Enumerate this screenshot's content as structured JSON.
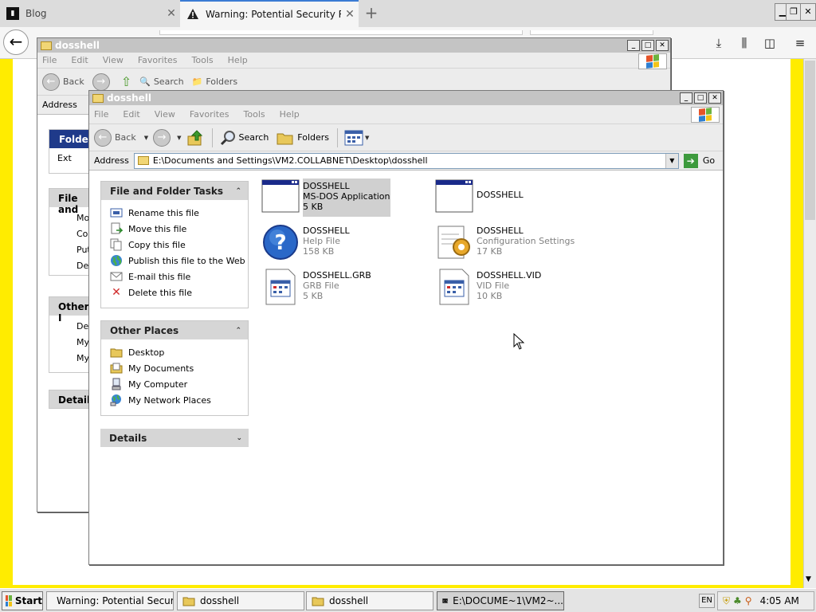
{
  "browser": {
    "tabs": [
      {
        "title": "Blog",
        "active": false
      },
      {
        "title": "Warning: Potential Security Risk A",
        "active": true
      }
    ],
    "new_tab": "+",
    "back": "←"
  },
  "back_window": {
    "title": "dosshell",
    "menu": [
      "File",
      "Edit",
      "View",
      "Favorites",
      "Tools",
      "Help"
    ],
    "back_label": "Back",
    "search_label": "Search",
    "folders_label": "Folders",
    "address_label": "Address",
    "panels": {
      "folder_head": "Folder",
      "folder_item": "Ext",
      "file_head": "File and",
      "file_items": [
        "Mo",
        "Cop",
        "Put",
        "Del"
      ],
      "other_head": "Other I",
      "other_items": [
        "Des",
        "My",
        "My"
      ],
      "details_head": "Details"
    }
  },
  "front_window": {
    "title": "dosshell",
    "menu": [
      "File",
      "Edit",
      "View",
      "Favorites",
      "Tools",
      "Help"
    ],
    "toolbar": {
      "back": "Back",
      "search": "Search",
      "folders": "Folders"
    },
    "address": {
      "label": "Address",
      "value": "E:\\Documents and Settings\\VM2.COLLABNET\\Desktop\\dosshell",
      "go": "Go"
    },
    "tasks_panel": {
      "title": "File and Folder Tasks",
      "items": [
        {
          "label": "Rename this file",
          "icon": "rename-icon"
        },
        {
          "label": "Move this file",
          "icon": "move-icon"
        },
        {
          "label": "Copy this file",
          "icon": "copy-icon"
        },
        {
          "label": "Publish this file to the Web",
          "icon": "globe-icon"
        },
        {
          "label": "E-mail this file",
          "icon": "email-icon"
        },
        {
          "label": "Delete this file",
          "icon": "delete-icon"
        }
      ]
    },
    "places_panel": {
      "title": "Other Places",
      "items": [
        {
          "label": "Desktop",
          "icon": "folder-icon"
        },
        {
          "label": "My Documents",
          "icon": "documents-icon"
        },
        {
          "label": "My Computer",
          "icon": "computer-icon"
        },
        {
          "label": "My Network Places",
          "icon": "network-icon"
        }
      ]
    },
    "details_panel": {
      "title": "Details"
    },
    "files": [
      {
        "name": "DOSSHELL",
        "type": "MS-DOS Application",
        "size": "5 KB",
        "icon": "msdos-app-icon",
        "selected": true
      },
      {
        "name": "DOSSHELL",
        "type": "",
        "size": "",
        "icon": "window-icon",
        "selected": false
      },
      {
        "name": "DOSSHELL",
        "type": "Help File",
        "size": "158 KB",
        "icon": "help-icon",
        "selected": false
      },
      {
        "name": "DOSSHELL",
        "type": "Configuration Settings",
        "size": "17 KB",
        "icon": "config-icon",
        "selected": false
      },
      {
        "name": "DOSSHELL.GRB",
        "type": "GRB File",
        "size": "5 KB",
        "icon": "grb-file-icon",
        "selected": false
      },
      {
        "name": "DOSSHELL.VID",
        "type": "VID File",
        "size": "10 KB",
        "icon": "vid-file-icon",
        "selected": false
      }
    ]
  },
  "taskbar": {
    "start": "Start",
    "buttons": [
      {
        "label": "Warning: Potential Secur...",
        "active": false
      },
      {
        "label": "dosshell",
        "active": false
      },
      {
        "label": "dosshell",
        "active": false
      },
      {
        "label": "E:\\DOCUME~1\\VM2~...",
        "active": true
      }
    ],
    "lang": "EN",
    "clock": "4:05 AM"
  }
}
